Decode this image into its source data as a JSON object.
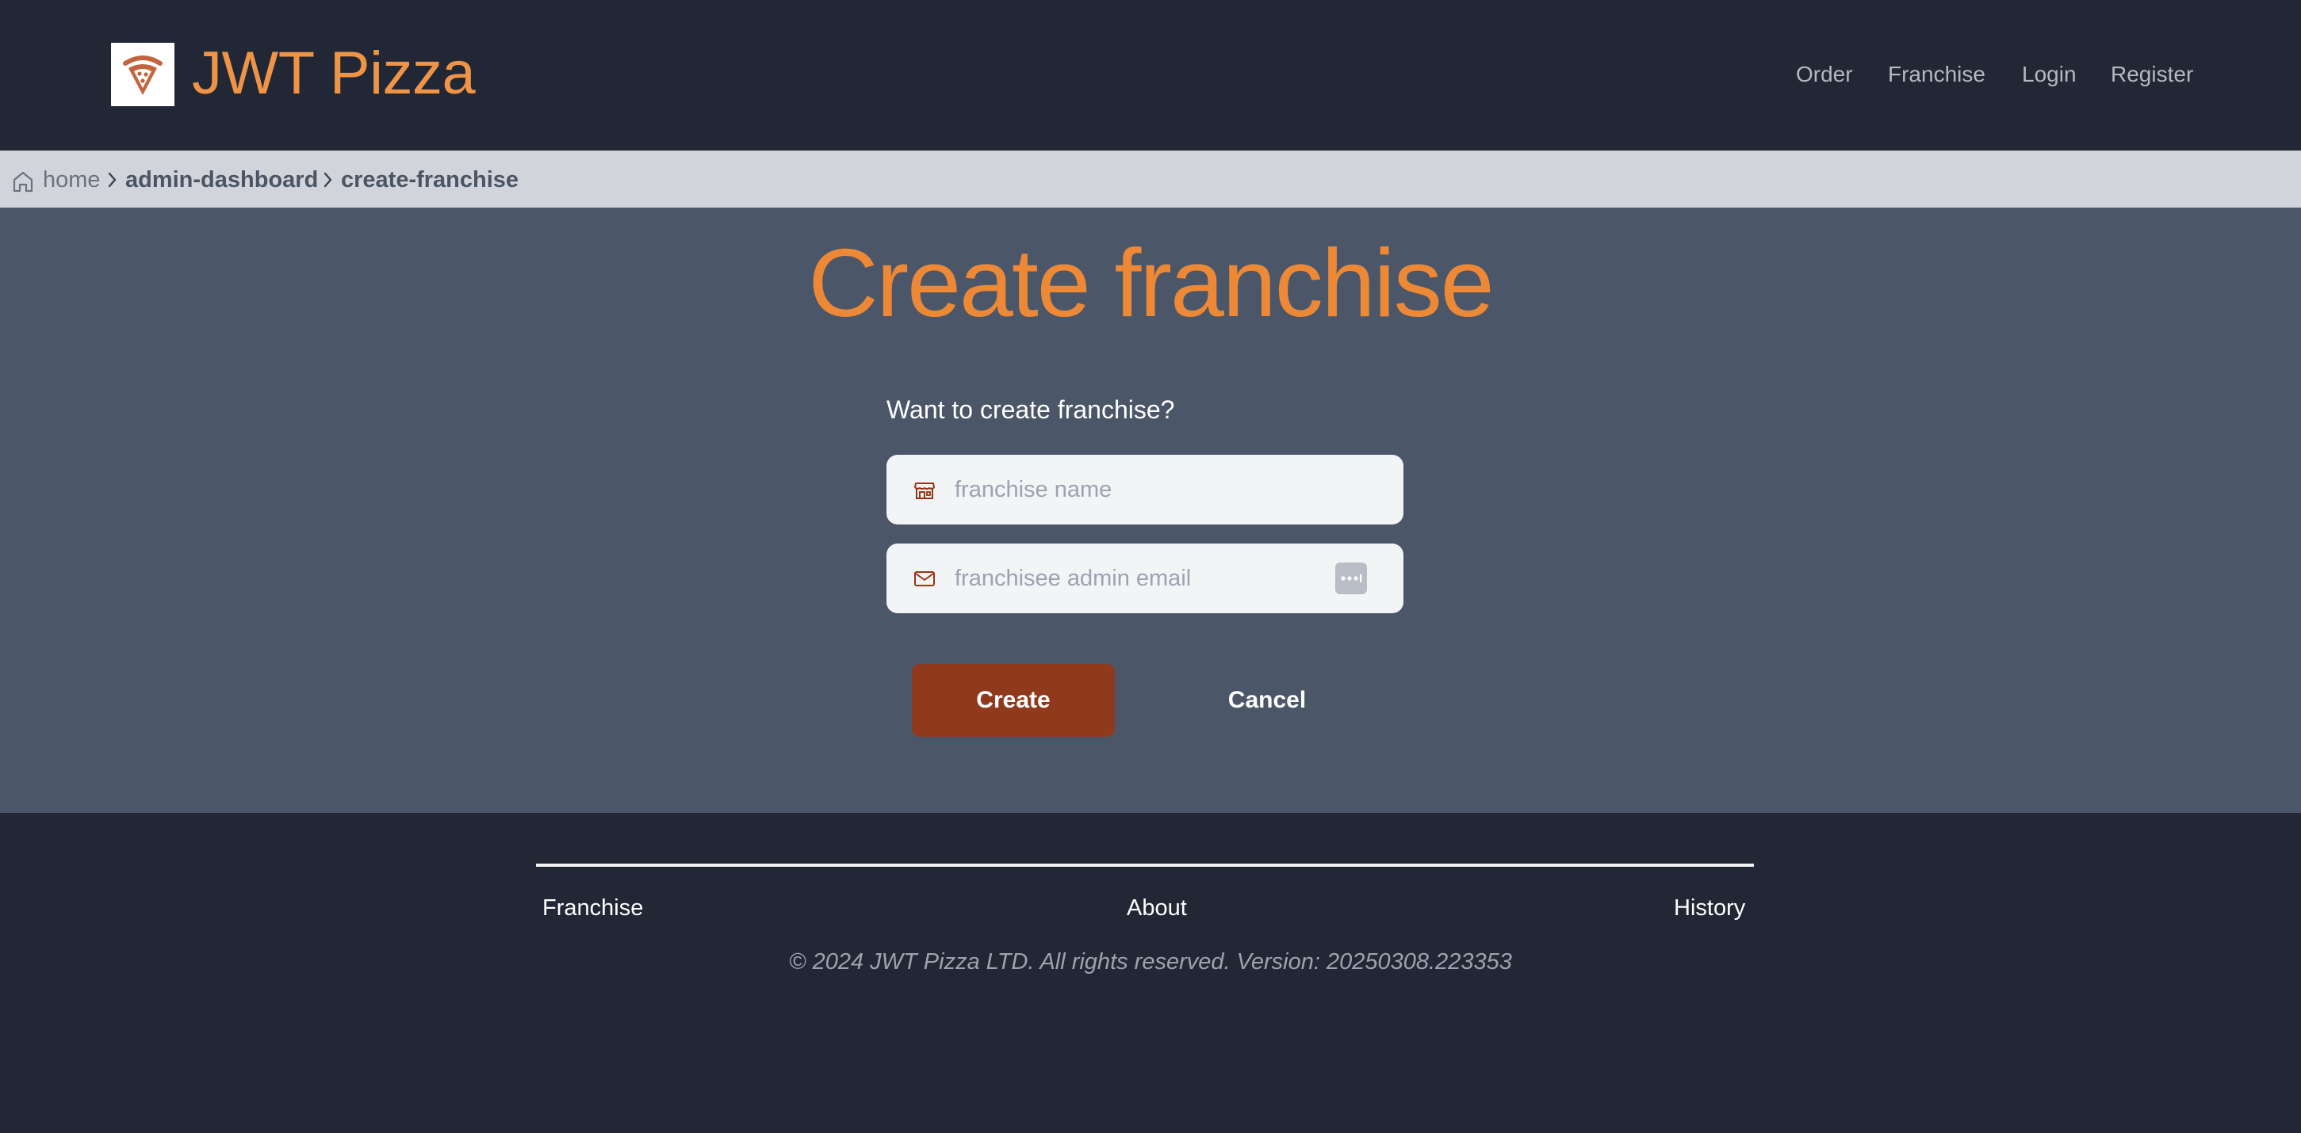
{
  "header": {
    "brand": "JWT Pizza",
    "logo_icon": "pizza-slice-icon",
    "nav": {
      "order": "Order",
      "franchise": "Franchise",
      "login": "Login",
      "register": "Register"
    }
  },
  "breadcrumb": {
    "home_icon": "home-icon",
    "items": [
      "home",
      "admin-dashboard",
      "create-franchise"
    ]
  },
  "main": {
    "title": "Create franchise",
    "subtitle": "Want to create franchise?",
    "fields": {
      "franchise_name": {
        "icon": "store-icon",
        "placeholder": "franchise name",
        "value": ""
      },
      "admin_email": {
        "icon": "mail-icon",
        "placeholder": "franchisee admin email",
        "value": "",
        "autofill_icon": "password-manager-icon"
      }
    },
    "buttons": {
      "create": "Create",
      "cancel": "Cancel"
    }
  },
  "footer": {
    "links": [
      "Franchise",
      "About",
      "History"
    ],
    "copyright": "© 2024 JWT Pizza LTD. All rights reserved. Version: 20250308.223353"
  },
  "colors": {
    "header_bg": "#212735",
    "brand_orange": "#ef9447",
    "main_bg": "#4b5769",
    "breadcrumb_bg": "#d1d5db",
    "create_button": "#8f3a1d",
    "icon_accent": "#9a3412"
  }
}
